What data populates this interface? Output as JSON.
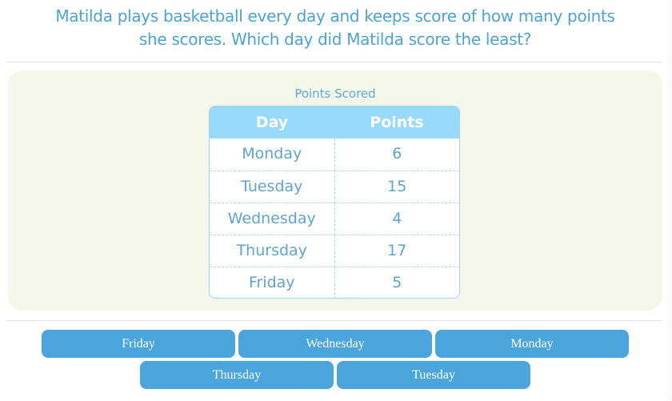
{
  "question": {
    "line1": "Matilda plays basketball every day and keeps score of how many points",
    "line2": "she scores. Which day did Matilda score the least?"
  },
  "table": {
    "title": "Points Scored",
    "headers": [
      "Day",
      "Points"
    ],
    "rows": [
      {
        "day": "Monday",
        "points": "6"
      },
      {
        "day": "Tuesday",
        "points": "15"
      },
      {
        "day": "Wednesday",
        "points": "4"
      },
      {
        "day": "Thursday",
        "points": "17"
      },
      {
        "day": "Friday",
        "points": "5"
      }
    ]
  },
  "answers": [
    [
      "Friday",
      "Wednesday",
      "Monday"
    ],
    [
      "Thursday",
      "Tuesday"
    ]
  ],
  "colors": {
    "accent": "#4aa3db",
    "button": "#4aa5dd",
    "table_header": "#98dafc",
    "panel_bg": "#f4f7ea"
  }
}
